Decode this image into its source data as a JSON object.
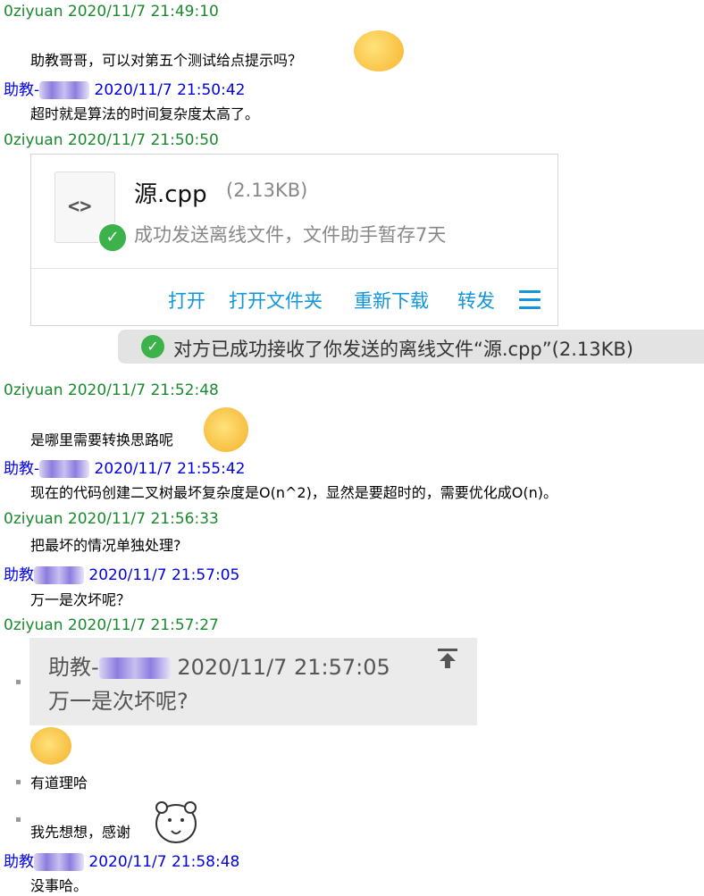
{
  "messages": [
    {
      "sender": "0ziyuan",
      "time": "2020/11/7 21:49:10",
      "text": "助教哥哥，可以对第五个测试给点提示吗？"
    },
    {
      "sender": "助教-",
      "time": "2020/11/7 21:50:42",
      "text": "超时就是算法的时间复杂度太高了。"
    },
    {
      "sender": "0ziyuan",
      "time": "2020/11/7 21:50:50"
    },
    {
      "sender": "0ziyuan",
      "time": "2020/11/7 21:52:48",
      "text": "是哪里需要转换思路呢"
    },
    {
      "sender": "助教-",
      "time": "2020/11/7 21:55:42",
      "text": "现在的代码创建二叉树最坏复杂度是O(n^2)，显然是要超时的，需要优化成O(n)。"
    },
    {
      "sender": "0ziyuan",
      "time": "2020/11/7 21:56:33",
      "text": "把最坏的情况单独处理?"
    },
    {
      "sender": "助教",
      "time": "2020/11/7 21:57:05",
      "text": "万一是次坏呢？"
    },
    {
      "sender": "0ziyuan",
      "time": "2020/11/7 21:57:27",
      "line1": "有道理哈",
      "line2": "我先想想，感谢"
    },
    {
      "sender": "助教",
      "time": "2020/11/7 21:58:48",
      "text": "没事哈。"
    }
  ],
  "file_card": {
    "name": "源.cpp",
    "size": "(2.13KB)",
    "status": "成功发送离线文件，文件助手暂存7天",
    "icon": "code-file-icon",
    "actions": [
      "打开",
      "打开文件夹",
      "重新下载",
      "转发"
    ]
  },
  "notice": {
    "text": "对方已成功接收了你发送的离线文件“源.cpp”(2.13KB)"
  },
  "quote": {
    "sender": "助教-",
    "time": "2020/11/7 21:57:05",
    "text": "万一是次坏呢?"
  },
  "colors": {
    "me": "#1a8a2e",
    "ta": "#0000e6",
    "link": "#1296db",
    "success": "#3bb34a"
  }
}
